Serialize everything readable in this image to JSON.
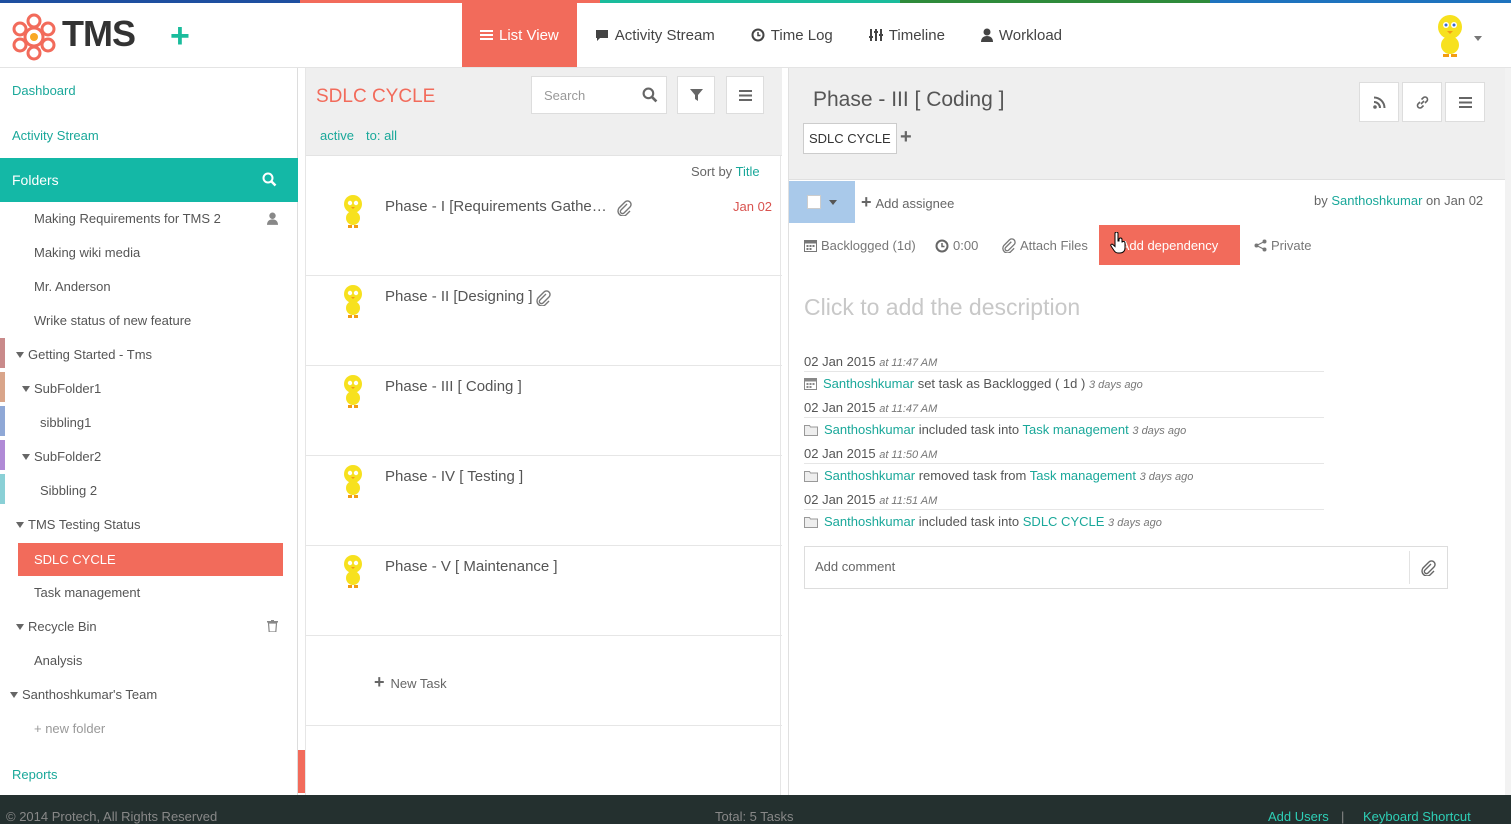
{
  "top_stripe_colors": [
    "#1e4fa0",
    "#f26b5b",
    "#1abc9c",
    "#2e8b3b",
    "#1e73be"
  ],
  "header": {
    "logo_text": "TMS",
    "nav": [
      {
        "label": "List View",
        "icon": "list-icon"
      },
      {
        "label": "Activity Stream",
        "icon": "comment-icon"
      },
      {
        "label": "Time Log",
        "icon": "clock-icon"
      },
      {
        "label": "Timeline",
        "icon": "sliders-icon"
      },
      {
        "label": "Workload",
        "icon": "user-icon"
      }
    ]
  },
  "sidebar": {
    "dashboard": "Dashboard",
    "activity_stream": "Activity Stream",
    "folders": "Folders",
    "items": [
      {
        "label": "Making Requirements for TMS 2"
      },
      {
        "label": "Making wiki media"
      },
      {
        "label": "Mr. Anderson"
      },
      {
        "label": "Wrike status of new feature"
      },
      {
        "label": "Getting Started - Tms",
        "color": "#c98a8a"
      },
      {
        "label": "SubFolder1",
        "color": "#d9a58a"
      },
      {
        "label": "sibbling1",
        "color": "#8fa8d6"
      },
      {
        "label": "SubFolder2",
        "color": "#b08ad6"
      },
      {
        "label": "Sibbling 2",
        "color": "#8ad0d6"
      },
      {
        "label": "TMS Testing Status"
      },
      {
        "label": "SDLC CYCLE"
      },
      {
        "label": "Task management"
      },
      {
        "label": "Recycle Bin"
      },
      {
        "label": "Analysis"
      },
      {
        "label": "Santhoshkumar's Team"
      }
    ],
    "new_folder": "+ new folder",
    "reports": "Reports"
  },
  "list": {
    "title": "SDLC CYCLE",
    "search_placeholder": "Search",
    "filter_active": "active",
    "filter_to": "to: all",
    "sort_prefix": "Sort by",
    "sort_field": "Title",
    "tasks": [
      {
        "title": "Phase - I [Requirements Gathe…",
        "date": "Jan 02",
        "attachment": true
      },
      {
        "title": "Phase - II [Designing ]",
        "date": "",
        "attachment": true
      },
      {
        "title": "Phase - III [ Coding ]",
        "date": "",
        "attachment": false
      },
      {
        "title": "Phase - IV [ Testing ]",
        "date": "",
        "attachment": false
      },
      {
        "title": "Phase - V [ Maintenance ]",
        "date": "",
        "attachment": false
      }
    ],
    "new_task": "New Task"
  },
  "detail": {
    "title": "Phase - III [ Coding ]",
    "tag": "SDLC CYCLE",
    "add_assignee": "Add assignee",
    "by_prefix": "by",
    "by_user": "Santhoshkumar",
    "by_suffix": "on Jan 02",
    "status": "Backlogged (1d)",
    "time": "0:00",
    "attach": "Attach Files",
    "add_dependency": "Add dependency",
    "privacy": "Private",
    "description_placeholder": "Click to add the description",
    "activity": [
      {
        "date": "02 Jan 2015",
        "time": "at 11:47 AM",
        "user": "Santhoshkumar",
        "action": "set task as Backlogged ( 1d )",
        "target": "",
        "ago": "3 days ago"
      },
      {
        "date": "02 Jan 2015",
        "time": "at 11:47 AM",
        "user": "Santhoshkumar",
        "action": "included task into",
        "target": "Task management",
        "ago": "3 days ago"
      },
      {
        "date": "02 Jan 2015",
        "time": "at 11:50 AM",
        "user": "Santhoshkumar",
        "action": "removed task from",
        "target": "Task management",
        "ago": "3 days ago"
      },
      {
        "date": "02 Jan 2015",
        "time": "at 11:51 AM",
        "user": "Santhoshkumar",
        "action": "included task into",
        "target": "SDLC CYCLE",
        "ago": "3 days ago"
      }
    ],
    "comment_placeholder": "Add comment"
  },
  "footer": {
    "copyright": "© 2014 Protech, All Rights Reserved",
    "total": "Total: 5 Tasks",
    "add_users": "Add Users",
    "separator": "|",
    "keyboard": "Keyboard Shortcut"
  },
  "colors": {
    "accent": "#f26b5b",
    "teal": "#14b8a6",
    "link": "#1aa89a"
  }
}
